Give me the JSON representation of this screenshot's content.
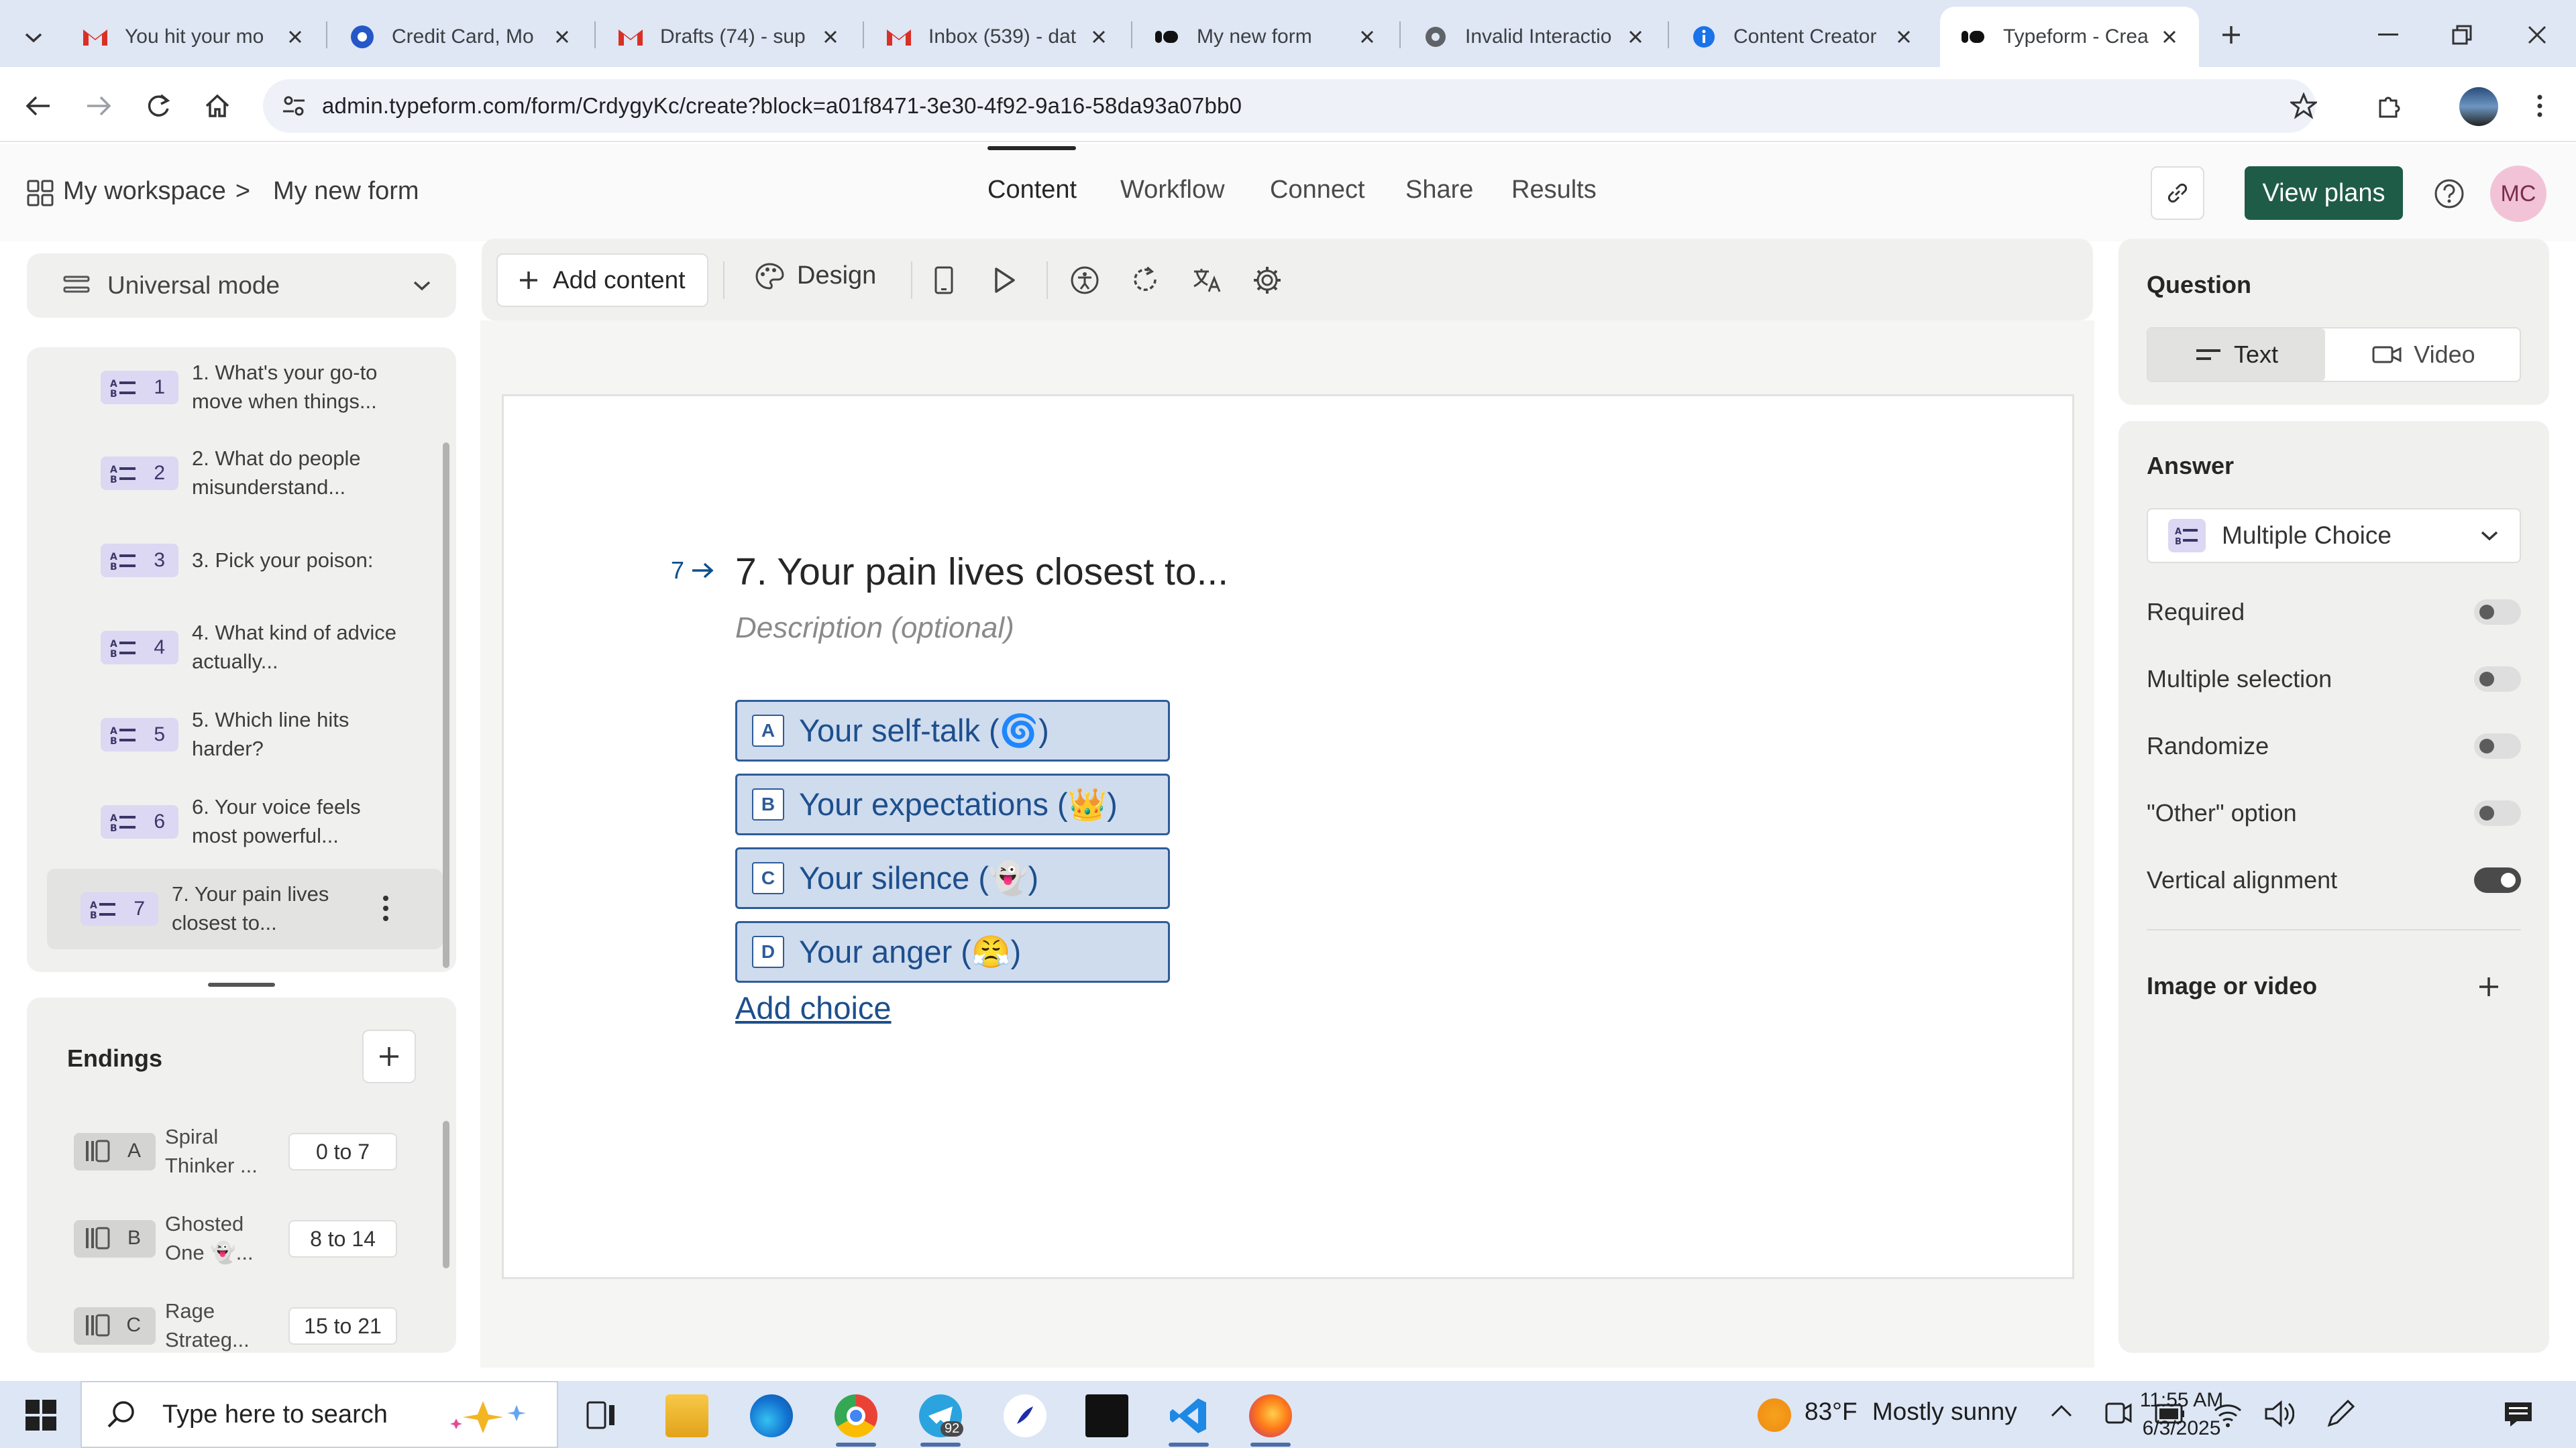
{
  "browser": {
    "tabs": [
      {
        "title": "You hit your mo",
        "icon": "gmail-icon"
      },
      {
        "title": "Credit Card, Mo",
        "icon": "site-icon"
      },
      {
        "title": "Drafts (74) - sup",
        "icon": "gmail-icon"
      },
      {
        "title": "Inbox (539) - dat",
        "icon": "gmail-icon"
      },
      {
        "title": "My new form",
        "icon": "typeform-icon"
      },
      {
        "title": "Invalid Interactio",
        "icon": "gear-icon"
      },
      {
        "title": "Content Creator",
        "icon": "info-icon"
      },
      {
        "title": "Typeform - Crea",
        "icon": "typeform-icon",
        "active": true
      }
    ],
    "url": "admin.typeform.com/form/CrdygyKc/create?block=a01f8471-3e30-4f92-9a16-58da93a07bb0"
  },
  "header": {
    "breadcrumb_root": "My workspace",
    "breadcrumb_sep": ">",
    "form_name": "My new form",
    "nav": [
      "Content",
      "Workflow",
      "Connect",
      "Share",
      "Results"
    ],
    "active_nav": "Content",
    "plans_label": "View plans",
    "avatar_initials": "MC"
  },
  "sidebar": {
    "mode_label": "Universal mode",
    "questions": [
      {
        "num": "1",
        "label": "1. What's your go-to move when things..."
      },
      {
        "num": "2",
        "label": "2. What do people misunderstand..."
      },
      {
        "num": "3",
        "label": "3. Pick your poison:"
      },
      {
        "num": "4",
        "label": "4. What kind of advice actually..."
      },
      {
        "num": "5",
        "label": "5. Which line hits harder?"
      },
      {
        "num": "6",
        "label": "6. Your voice feels most powerful..."
      },
      {
        "num": "7",
        "label": "7. Your pain lives closest to..."
      }
    ],
    "selected_question": 7,
    "endings_title": "Endings",
    "endings": [
      {
        "letter": "A",
        "label": "Spiral Thinker ...",
        "range": "0 to 7"
      },
      {
        "letter": "B",
        "label": "Ghosted One 👻...",
        "range": "8 to 14"
      },
      {
        "letter": "C",
        "label": "Rage Strateg...",
        "range": "15 to 21"
      }
    ]
  },
  "builder_toolbar": {
    "add_content_label": "Add content",
    "design_label": "Design"
  },
  "question": {
    "number": "7",
    "title": "7. Your pain lives closest to...",
    "description_placeholder": "Description (optional)",
    "choices": [
      {
        "key": "A",
        "text": "Your self-talk (🌀)"
      },
      {
        "key": "B",
        "text": "Your expectations (👑)"
      },
      {
        "key": "C",
        "text": "Your silence (👻)"
      },
      {
        "key": "D",
        "text": "Your anger (😤)"
      }
    ],
    "add_choice_label": "Add choice"
  },
  "right_panel": {
    "question_heading": "Question",
    "text_label": "Text",
    "video_label": "Video",
    "answer_heading": "Answer",
    "answer_type": "Multiple Choice",
    "settings": [
      {
        "label": "Required",
        "on": false
      },
      {
        "label": "Multiple selection",
        "on": false
      },
      {
        "label": "Randomize",
        "on": false
      },
      {
        "label": "\"Other\" option",
        "on": false
      },
      {
        "label": "Vertical alignment",
        "on": true
      }
    ],
    "media_heading": "Image or video"
  },
  "taskbar": {
    "search_placeholder": "Type here to search",
    "temperature": "83°F",
    "weather": "Mostly sunny",
    "time": "11:55 AM",
    "date": "6/3/2025",
    "telegram_badge": "92"
  },
  "colors": {
    "accent_green": "#1f5c48",
    "choice_fill": "#cfdcee",
    "choice_border": "#2e5c99",
    "badge_purple": "#dcd7f2"
  }
}
